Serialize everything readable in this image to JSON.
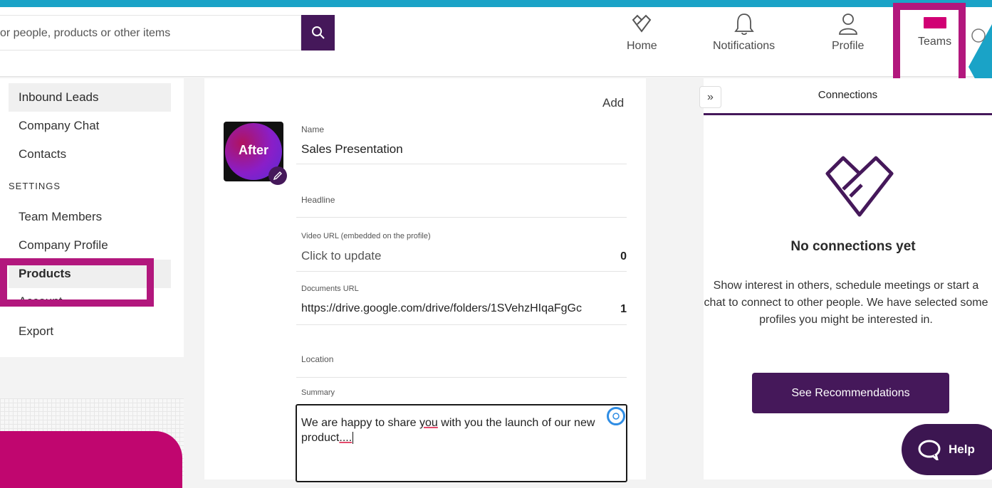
{
  "header": {
    "search_placeholder": "or people, products or other items",
    "nav": {
      "home": "Home",
      "notifications": "Notifications",
      "profile": "Profile",
      "teams": "Teams"
    }
  },
  "sidebar": {
    "items_top": [
      "Inbound Leads",
      "Company Chat",
      "Contacts"
    ],
    "settings_heading": "SETTINGS",
    "items_settings": [
      "Team Members",
      "Company Profile",
      "Products",
      "Account",
      "Export"
    ],
    "active_item": "Products"
  },
  "form": {
    "add_label": "Add",
    "avatar_text": "After",
    "name_label": "Name",
    "name_value": "Sales Presentation",
    "headline_label": "Headline",
    "video_label": "Video URL (embedded on the profile)",
    "video_value": "Click to update",
    "video_count": "0",
    "documents_label": "Documents URL",
    "documents_value": "https://drive.google.com/drive/folders/1SVehzHIqaFgGc",
    "documents_count": "1",
    "location_label": "Location",
    "summary_label": "Summary",
    "summary_pre": "We are happy to share ",
    "summary_underlined": "you",
    "summary_mid": " with you the launch of our new product",
    "summary_dots": "....",
    "summary_post": ""
  },
  "connections": {
    "tab_label": "Connections",
    "empty_title": "No connections yet",
    "empty_desc": "Show interest in others, schedule meetings or start a chat to connect to other people. We have selected some profiles you might be interested in.",
    "recommend_button": "See Recommendations"
  },
  "help": {
    "label": "Help"
  },
  "colors": {
    "accent_purple": "#45185a",
    "highlight_magenta": "#b2177d",
    "brand_pink": "#c0066f",
    "top_strip": "#1aa3c7"
  }
}
